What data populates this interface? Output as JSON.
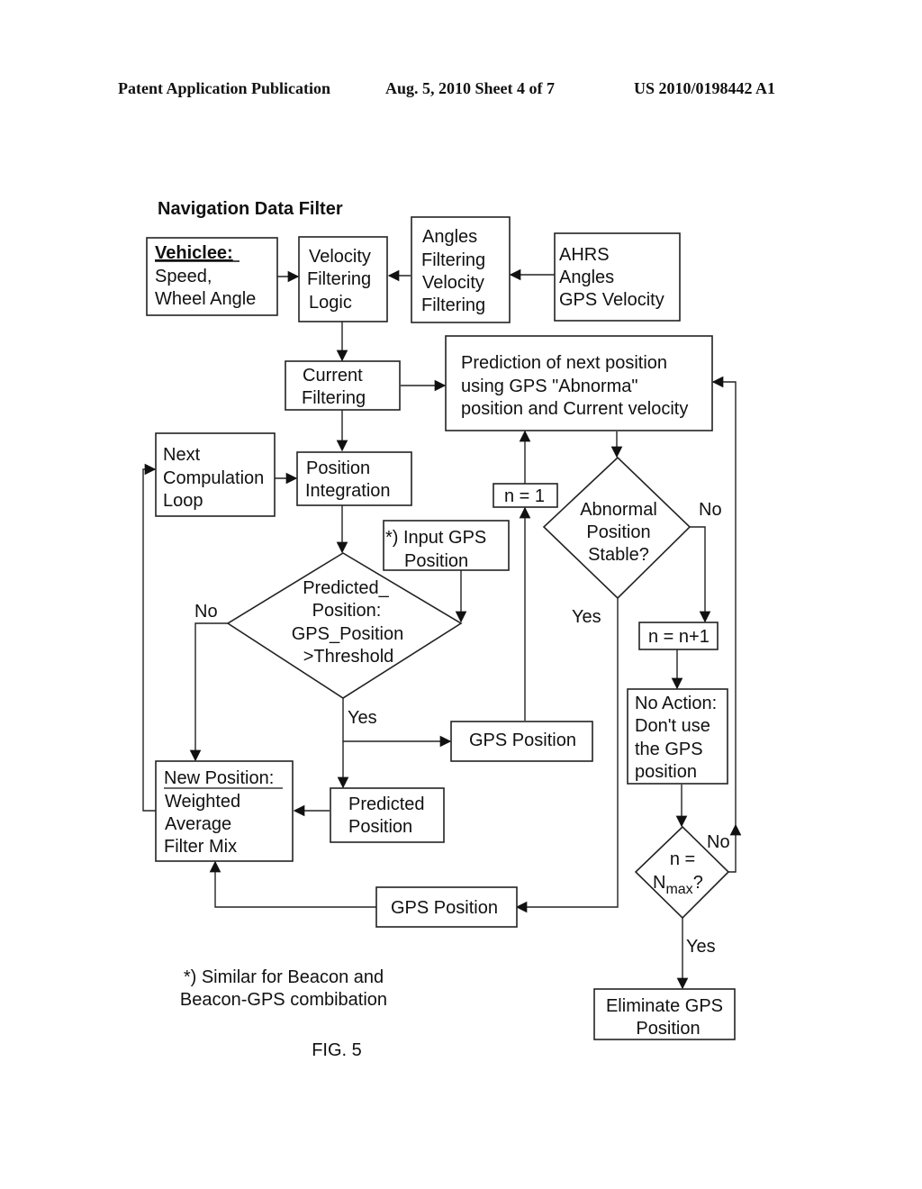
{
  "header": {
    "left": "Patent Application Publication",
    "date_sheet": "Aug. 5, 2010   Sheet 4 of 7",
    "number": "US 2010/0198442 A1"
  },
  "figure": {
    "title": "Navigation Data Filter",
    "caption": "FIG. 5",
    "footnote": [
      "*) Similar for Beacon and",
      "Beacon-GPS combibation"
    ]
  },
  "nodes": {
    "vehicle": {
      "heading": "Vehiclee:",
      "lines": [
        "Speed,",
        "Wheel Angle"
      ]
    },
    "velocity_filtering_logic": {
      "lines": [
        "Velocity",
        "Filtering",
        "Logic"
      ]
    },
    "angles_velocity_filtering": {
      "lines": [
        "Angles",
        "Filtering",
        "Velocity",
        "Filtering"
      ]
    },
    "ahrs": {
      "lines": [
        "AHRS",
        "Angles",
        "GPS Velocity"
      ]
    },
    "current_filtering": {
      "lines": [
        "Current",
        "Filtering"
      ]
    },
    "prediction": {
      "lines": [
        "Prediction of next position",
        "using GPS \"Abnorma\"",
        "position and Current velocity"
      ]
    },
    "next_loop": {
      "lines": [
        "Next",
        "Compulation",
        "Loop"
      ]
    },
    "position_integration": {
      "lines": [
        "Position",
        "Integration"
      ]
    },
    "n_equals_1": {
      "lines": [
        "n = 1"
      ]
    },
    "abnormal_stable": {
      "lines": [
        "Abnormal",
        "Position",
        "Stable?"
      ]
    },
    "input_gps": {
      "lines": [
        "*) Input GPS",
        "Position"
      ]
    },
    "threshold_decision": {
      "lines": [
        "Predicted_",
        "Position:",
        "GPS_Position",
        ">Threshold"
      ]
    },
    "n_increment": {
      "lines": [
        "n = n+1"
      ]
    },
    "no_action": {
      "lines": [
        "No Action:",
        "Don't use",
        "the GPS",
        "position"
      ]
    },
    "gps_position_1": {
      "lines": [
        "GPS Position"
      ]
    },
    "new_position": {
      "heading": "New Position:",
      "lines": [
        "Weighted",
        "Average",
        "Filter Mix"
      ]
    },
    "predicted_position": {
      "lines": [
        "Predicted",
        "Position"
      ]
    },
    "n_max_decision": {
      "line1": "n =",
      "n": "N",
      "sub": "max",
      "q": "?"
    },
    "gps_position_2": {
      "lines": [
        "GPS Position"
      ]
    },
    "eliminate_gps": {
      "lines": [
        "Eliminate GPS",
        "Position"
      ]
    }
  },
  "edge_labels": {
    "abnormal_no": "No",
    "abnormal_yes": "Yes",
    "threshold_no": "No",
    "threshold_yes": "Yes",
    "nmax_no": "No",
    "nmax_yes": "Yes"
  }
}
